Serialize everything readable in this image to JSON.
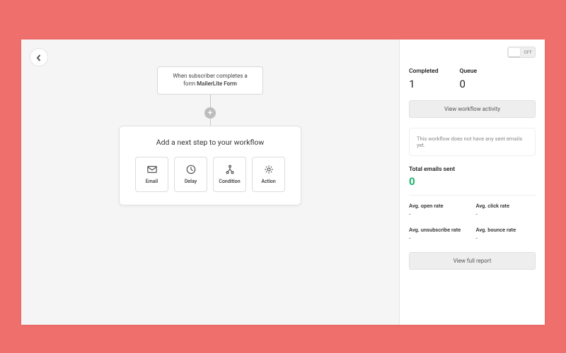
{
  "canvas": {
    "trigger_line1": "When subscriber completes a",
    "trigger_line2_pre": "form ",
    "trigger_line2_bold": "MailerLite Form",
    "step_panel_title": "Add a next step to your workflow",
    "options": [
      {
        "label": "Email"
      },
      {
        "label": "Delay"
      },
      {
        "label": "Condition"
      },
      {
        "label": "Action"
      }
    ]
  },
  "side": {
    "toggle_label": "OFF",
    "completed_label": "Completed",
    "completed_value": "1",
    "queue_label": "Queue",
    "queue_value": "0",
    "view_activity": "View workflow activity",
    "notice": "This workflow does not have any sent emails yet.",
    "total_sent_label": "Total emails sent",
    "total_sent_value": "0",
    "metrics": {
      "open": {
        "label": "Avg. open rate",
        "value": "-"
      },
      "click": {
        "label": "Avg. click rate",
        "value": "-"
      },
      "unsub": {
        "label": "Avg. unsubscribe rate",
        "value": "-"
      },
      "bounce": {
        "label": "Avg. bounce rate",
        "value": "-"
      }
    },
    "view_report": "View full report"
  },
  "colors": {
    "accent_green": "#1eb36b"
  }
}
